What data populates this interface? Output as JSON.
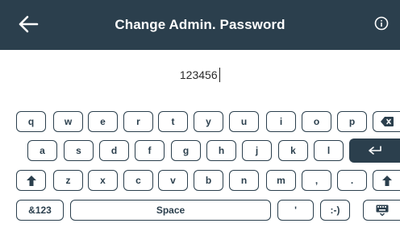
{
  "header": {
    "title": "Change Admin. Password",
    "back_icon": "arrow-left-icon",
    "info_icon": "info-circle-icon",
    "background": "#2b3f4d"
  },
  "password_field": {
    "value": "123456"
  },
  "keyboard": {
    "row1": [
      "q",
      "w",
      "e",
      "r",
      "t",
      "y",
      "u",
      "i",
      "o",
      "p"
    ],
    "row2": [
      "a",
      "s",
      "d",
      "f",
      "g",
      "h",
      "j",
      "k",
      "l"
    ],
    "row3": [
      "z",
      "x",
      "c",
      "v",
      "b",
      "n",
      "m",
      ",",
      "."
    ],
    "symbols_label": "&123",
    "space_label": "Space",
    "apostrophe_label": "'",
    "smiley_label": ":-)",
    "icons": {
      "backspace": "backspace-icon",
      "enter": "enter-icon",
      "shift": "shift-icon",
      "keyboard_hide": "keyboard-hide-icon"
    }
  }
}
